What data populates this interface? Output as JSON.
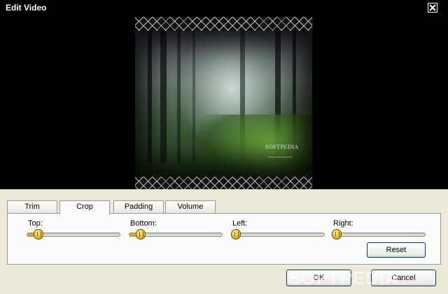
{
  "window": {
    "title": "Edit Video"
  },
  "tabs": [
    {
      "label": "Trim",
      "active": false
    },
    {
      "label": "Crop",
      "active": true
    },
    {
      "label": "Padding",
      "active": false
    },
    {
      "label": "Volume",
      "active": false
    }
  ],
  "crop": {
    "top": {
      "label": "Top:",
      "value": 0
    },
    "bottom": {
      "label": "Bottom:",
      "value": 0
    },
    "left": {
      "label": "Left:",
      "value": 0
    },
    "right": {
      "label": "Right:",
      "value": 0
    },
    "reset_label": "Reset"
  },
  "buttons": {
    "ok_label": "OK",
    "cancel_label": "Cancel"
  },
  "preview": {
    "overlay_text": "SOFTPEDIA",
    "overlay_small": "www.softpedia.com"
  },
  "watermark": "SOFTPEDIA",
  "colors": {
    "slider_accent": "#e8a317",
    "panel_bg": "#ece9d8",
    "button_border": "#003c74"
  },
  "icons": {
    "close": "close-icon",
    "slider_thumb": "slider-thumb-icon"
  }
}
